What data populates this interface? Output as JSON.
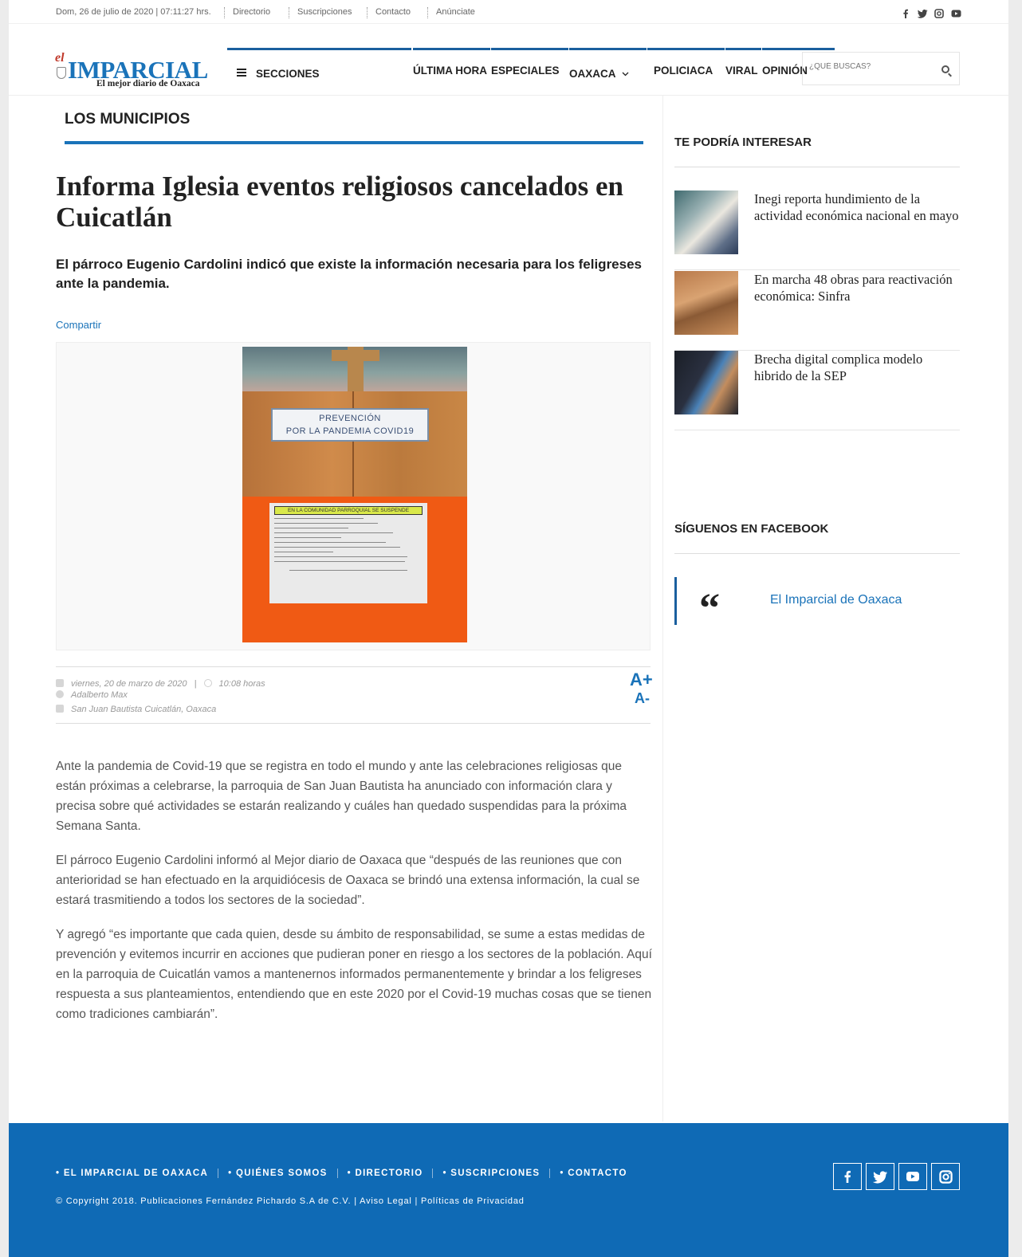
{
  "topbar": {
    "date": "Dom, 26 de julio de 2020 | 07:11:27 hrs.",
    "links": [
      "Directorio",
      "Suscripciones",
      "Contacto",
      "Anúnciate"
    ]
  },
  "logo": {
    "prefix": "el",
    "name": "IMPARCIAL",
    "tagline": "El mejor diario de Oaxaca"
  },
  "nav": {
    "items": [
      "SECCIONES",
      "ÚLTIMA HORA",
      "ESPECIALES",
      "OAXACA",
      "POLICIACA",
      "VIRAL",
      "OPINIÓN"
    ]
  },
  "search": {
    "placeholder": "¿QUÉ BUSCAS?"
  },
  "section": {
    "title": "LOS MUNICIPIOS"
  },
  "article": {
    "headline": "Informa Iglesia eventos religiosos cancelados en Cuicatlán",
    "subhead": "El párroco Eugenio Cardolini indicó que existe la información necesaria para los feligreses ante la pandemia.",
    "share_label": "Compartir",
    "date": "viernes, 20 de marzo de 2020",
    "time": "10:08 horas",
    "author": "Adalberto Max",
    "location": "San Juan Bautista Cuicatlán, Oaxaca",
    "font_up": "A+",
    "font_down": "A-",
    "paragraphs": [
      "Ante la pandemia de Covid-19 que se registra en todo el mundo y ante las celebraciones religiosas que están próximas a celebrarse, la parroquia de San Juan Bautista ha anunciado con información clara y precisa sobre qué actividades se estarán realizando y cuáles han quedado suspendidas para la próxima Semana Santa.",
      "El párroco Eugenio Cardolini informó al Mejor diario de Oaxaca que “después de las reuniones que con anterioridad se han efectuado en la arquidiócesis de Oaxaca se brindó una extensa información, la cual se estará trasmitiendo a todos los sectores de la sociedad”.",
      "Y agregó “es importante que cada quien, desde su ámbito de responsabilidad, se sume a estas medidas de prevención y evitemos incurrir en acciones que pudieran poner en riesgo a los sectores de la población. Aquí en la parroquia de Cuicatlán vamos a mantenernos informados permanentemente y brindar a los feligreses respuesta a sus planteamientos, entendiendo que en este 2020 por el Covid-19 muchas cosas que se tienen como tradiciones cambiarán”."
    ]
  },
  "photo_sign": {
    "top_line1": "PREVENCIÓN",
    "top_line2": "POR LA PANDEMIA COVID19",
    "list_header": "EN LA COMUNIDAD PARROQUIAL SE SUSPENDE"
  },
  "sidebar": {
    "related_title": "TE PODRÍA INTERESAR",
    "related": [
      "Inegi reporta hundimiento de la actividad económica nacional en mayo",
      "En marcha 48 obras para reactivación económica: Sinfra",
      "Brecha digital complica modelo hibrido de la SEP"
    ],
    "facebook_title": "SÍGUENOS EN FACEBOOK",
    "quote_mark": "“",
    "facebook_link": "El Imparcial de Oaxaca"
  },
  "footer": {
    "links": [
      "• EL IMPARCIAL DE OAXACA",
      "• QUIÉNES SOMOS",
      "• DIRECTORIO",
      "• SUSCRIPCIONES",
      "• CONTACTO"
    ],
    "copyright": "© Copyright 2018. Publicaciones Fernández Pichardo S.A de C.V. | Aviso Legal | Políticas de Privacidad"
  },
  "colors": {
    "brand_blue": "#1a73b9",
    "footer_blue": "#0f6ab5",
    "nav_accent": "#1a5f9e"
  },
  "icons": [
    "facebook-icon",
    "twitter-icon",
    "instagram-icon",
    "youtube-icon",
    "search-icon",
    "menu-icon",
    "calendar-icon",
    "clock-icon",
    "user-icon",
    "map-icon"
  ]
}
